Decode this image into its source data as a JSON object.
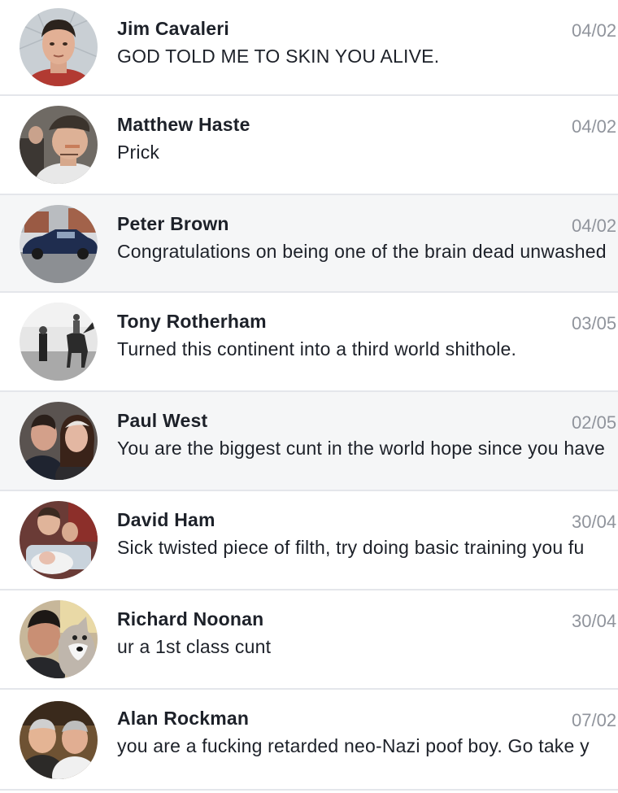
{
  "threads": [
    {
      "sender": "Jim Cavaleri",
      "date": "04/02",
      "snippet": "GOD TOLD ME TO SKIN YOU ALIVE.",
      "avatar": "avatar-portrait-icon"
    },
    {
      "sender": "Matthew Haste",
      "date": "04/02",
      "snippet": "Prick",
      "avatar": "avatar-portrait-icon"
    },
    {
      "sender": "Peter Brown",
      "date": "04/02",
      "snippet": "Congratulations on being one of the brain dead unwashed",
      "avatar": "avatar-car-icon"
    },
    {
      "sender": "Tony Rotherham",
      "date": "03/05",
      "snippet": "Turned this continent into a third world shithole.",
      "avatar": "avatar-horse-rider-icon"
    },
    {
      "sender": "Paul West",
      "date": "02/05",
      "snippet": "You are the biggest cunt in the world hope since you have",
      "avatar": "avatar-couple-icon"
    },
    {
      "sender": "David Ham",
      "date": "30/04",
      "snippet": "Sick twisted piece of filth, try doing basic training you fu",
      "avatar": "avatar-family-icon"
    },
    {
      "sender": "Richard Noonan",
      "date": "30/04",
      "snippet": "ur a 1st class cunt",
      "avatar": "avatar-man-with-dog-icon"
    },
    {
      "sender": "Alan Rockman",
      "date": "07/02",
      "snippet": "you are a fucking retarded neo-Nazi poof boy. Go take y",
      "avatar": "avatar-two-men-icon"
    }
  ]
}
